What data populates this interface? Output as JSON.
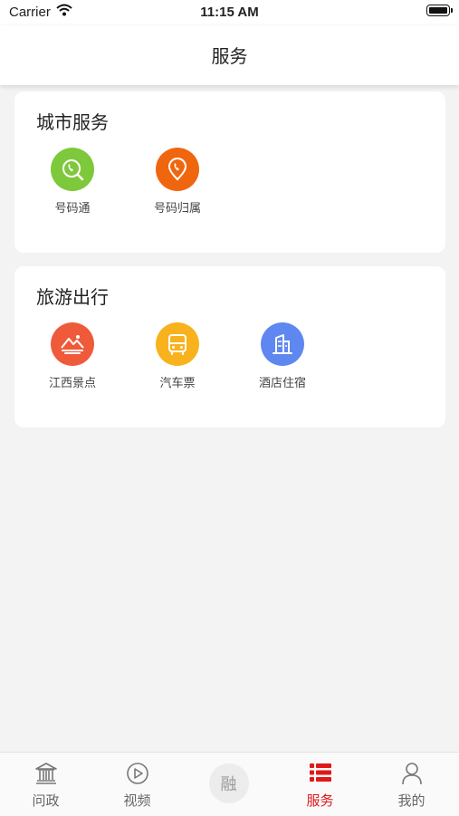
{
  "status": {
    "carrier": "Carrier",
    "time": "11:15 AM"
  },
  "nav": {
    "title": "服务"
  },
  "city": {
    "heading": "城市服务",
    "items": [
      {
        "label": "号码通",
        "icon": "phone-search-icon",
        "color": "#7ec83b"
      },
      {
        "label": "号码归属",
        "icon": "phone-location-icon",
        "color": "#f0660e"
      }
    ]
  },
  "travel": {
    "heading": "旅游出行",
    "items": [
      {
        "label": "江西景点",
        "icon": "landscape-icon",
        "color": "#ef5a3a"
      },
      {
        "label": "汽车票",
        "icon": "bus-icon",
        "color": "#f8b21d"
      },
      {
        "label": "酒店住宿",
        "icon": "hotel-building-icon",
        "color": "#5e87f0"
      }
    ]
  },
  "tabs": {
    "items": [
      {
        "label": "问政",
        "icon": "government-building-icon"
      },
      {
        "label": "视频",
        "icon": "play-circle-icon"
      },
      {
        "label": "融",
        "icon": "rong-center-icon"
      },
      {
        "label": "服务",
        "icon": "list-icon",
        "active": true
      },
      {
        "label": "我的",
        "icon": "person-icon"
      }
    ],
    "active_color": "#e21818"
  }
}
